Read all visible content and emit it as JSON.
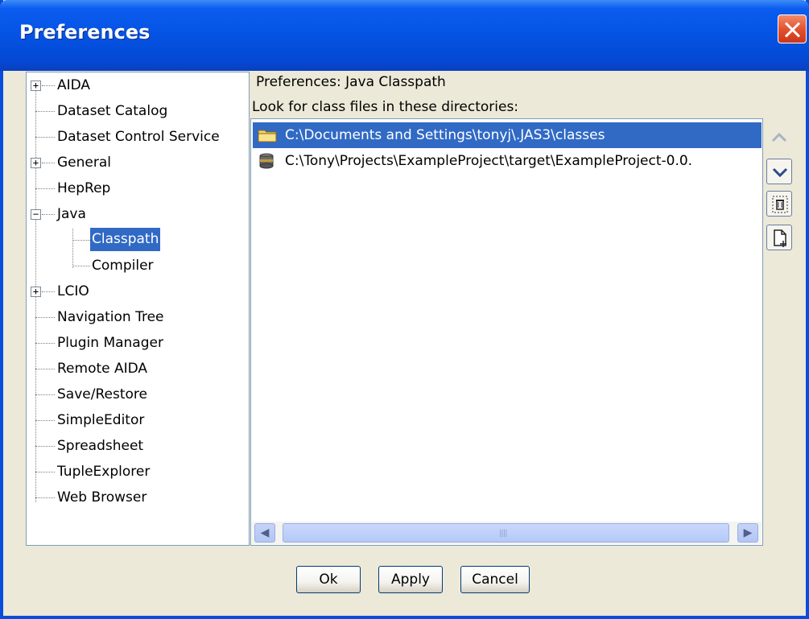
{
  "window": {
    "title": "Preferences"
  },
  "tree": {
    "items": [
      {
        "label": "AIDA",
        "expander": "+"
      },
      {
        "label": "Dataset Catalog"
      },
      {
        "label": "Dataset Control Service"
      },
      {
        "label": "General",
        "expander": "+"
      },
      {
        "label": "HepRep"
      },
      {
        "label": "Java",
        "expander": "−"
      },
      {
        "label": "Classpath",
        "selected": true
      },
      {
        "label": "Compiler"
      },
      {
        "label": "LCIO",
        "expander": "+"
      },
      {
        "label": "Navigation Tree"
      },
      {
        "label": "Plugin Manager"
      },
      {
        "label": "Remote AIDA"
      },
      {
        "label": "Save/Restore"
      },
      {
        "label": "SimpleEditor"
      },
      {
        "label": "Spreadsheet"
      },
      {
        "label": "TupleExplorer"
      },
      {
        "label": "Web Browser"
      }
    ]
  },
  "panel": {
    "header": "Preferences: Java Classpath",
    "list_label": "Look for class files in these directories:",
    "entries": [
      {
        "path": "C:\\Documents and Settings\\tonyj\\.JAS3\\classes",
        "icon": "folder-icon",
        "selected": true
      },
      {
        "path": "C:\\Tony\\Projects\\ExampleProject\\target\\ExampleProject-0.0.",
        "icon": "jar-icon"
      }
    ],
    "side_buttons": [
      "move-up",
      "move-down",
      "remove",
      "add"
    ]
  },
  "buttons": {
    "ok": "Ok",
    "apply": "Apply",
    "cancel": "Cancel"
  },
  "colors": {
    "selection": "#316ac5",
    "titlebar": "#0553e3",
    "dialog_bg": "#ece9d8"
  }
}
